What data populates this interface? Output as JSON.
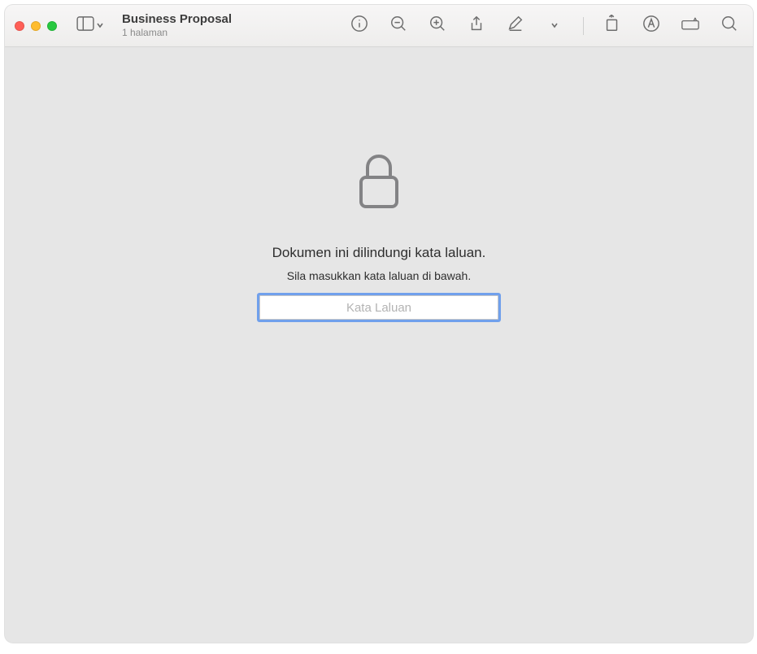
{
  "window": {
    "title": "Business Proposal",
    "subtitle": "1 halaman"
  },
  "toolbar": {
    "sidebar_toggle": "sidebar-toggle",
    "info": "info",
    "zoom_out": "zoom-out",
    "zoom_in": "zoom-in",
    "share": "share",
    "markup": "markup",
    "markup_more": "markup-more",
    "rotate": "rotate",
    "highlight": "highlight",
    "annotate_box": "annotate-box",
    "search": "search"
  },
  "lock_prompt": {
    "heading": "Dokumen ini dilindungi kata laluan.",
    "subheading": "Sila masukkan kata laluan di bawah.",
    "placeholder": "Kata Laluan"
  }
}
